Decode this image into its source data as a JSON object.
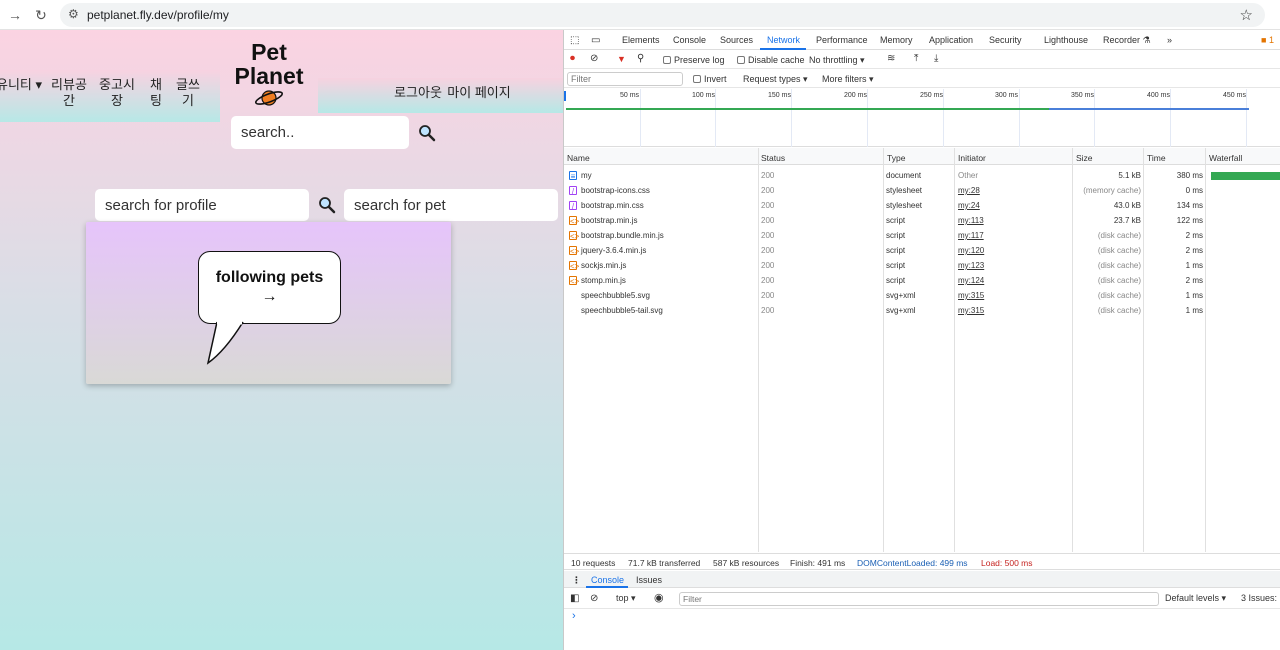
{
  "browser": {
    "url": "petplanet.fly.dev/profile/my"
  },
  "site": {
    "nav_left": [
      {
        "label": "유니티 ▾"
      },
      {
        "label": "리뷰공간"
      },
      {
        "label": "중고시장"
      },
      {
        "label": "채팅"
      },
      {
        "label": "글쓰기"
      }
    ],
    "nav_right": {
      "logout": "로그아웃",
      "mypage": "마이 페이지"
    },
    "logo_line1": "Pet",
    "logo_line2": "Planet",
    "search_placeholder": "search..",
    "profile_search_placeholder": "search for profile",
    "pet_search_placeholder": "search for pet",
    "bubble_text": "following pets",
    "bubble_arrow": "→",
    "colors": {
      "pink": "#fbd3e2",
      "mint": "#b6e8e6",
      "card_top": "#e6c4fb"
    }
  },
  "devtools": {
    "tabs": [
      "Elements",
      "Console",
      "Sources",
      "Network",
      "Performance",
      "Memory",
      "Application",
      "Security",
      "Lighthouse",
      "Recorder ⚗",
      "»"
    ],
    "active_tab": "Network",
    "badge": "1",
    "toolbar": {
      "preserve_log": "Preserve log",
      "disable_cache": "Disable cache",
      "throttling": "No throttling ▾"
    },
    "filter_placeholder": "Filter",
    "invert": "Invert",
    "request_types": "Request types ▾",
    "more_filters": "More filters ▾",
    "timeline_ticks": [
      "50 ms",
      "100 ms",
      "150 ms",
      "200 ms",
      "250 ms",
      "300 ms",
      "350 ms",
      "400 ms",
      "450 ms"
    ],
    "columns": [
      "Name",
      "Status",
      "Type",
      "Initiator",
      "Size",
      "Time",
      "Waterfall"
    ],
    "requests": [
      {
        "name": "my",
        "status": "200",
        "type": "document",
        "initiator": "Other",
        "size": "5.1 kB",
        "time": "380 ms",
        "kind": "doc"
      },
      {
        "name": "bootstrap-icons.css",
        "status": "200",
        "type": "stylesheet",
        "initiator": "my:28",
        "size": "(memory cache)",
        "time": "0 ms",
        "kind": "css"
      },
      {
        "name": "bootstrap.min.css",
        "status": "200",
        "type": "stylesheet",
        "initiator": "my:24",
        "size": "43.0 kB",
        "time": "134 ms",
        "kind": "css"
      },
      {
        "name": "bootstrap.min.js",
        "status": "200",
        "type": "script",
        "initiator": "my:113",
        "size": "23.7 kB",
        "time": "122 ms",
        "kind": "js"
      },
      {
        "name": "bootstrap.bundle.min.js",
        "status": "200",
        "type": "script",
        "initiator": "my:117",
        "size": "(disk cache)",
        "time": "2 ms",
        "kind": "js"
      },
      {
        "name": "jquery-3.6.4.min.js",
        "status": "200",
        "type": "script",
        "initiator": "my:120",
        "size": "(disk cache)",
        "time": "2 ms",
        "kind": "js"
      },
      {
        "name": "sockjs.min.js",
        "status": "200",
        "type": "script",
        "initiator": "my:123",
        "size": "(disk cache)",
        "time": "1 ms",
        "kind": "js"
      },
      {
        "name": "stomp.min.js",
        "status": "200",
        "type": "script",
        "initiator": "my:124",
        "size": "(disk cache)",
        "time": "2 ms",
        "kind": "js"
      },
      {
        "name": "speechbubble5.svg",
        "status": "200",
        "type": "svg+xml",
        "initiator": "my:315",
        "size": "(disk cache)",
        "time": "1 ms",
        "kind": "img"
      },
      {
        "name": "speechbubble5-tail.svg",
        "status": "200",
        "type": "svg+xml",
        "initiator": "my:315",
        "size": "(disk cache)",
        "time": "1 ms",
        "kind": "img"
      }
    ],
    "summary": {
      "requests": "10 requests",
      "transferred": "71.7 kB transferred",
      "resources": "587 kB resources",
      "finish": "Finish: 491 ms",
      "dcl": "DOMContentLoaded: 499 ms",
      "load": "Load: 500 ms"
    },
    "drawer_tabs": [
      "Console",
      "Issues"
    ],
    "console_context": "top ▾",
    "console_filter_placeholder": "Filter",
    "default_levels": "Default levels ▾",
    "issues_count": "3 Issues:",
    "prompt": "›"
  }
}
